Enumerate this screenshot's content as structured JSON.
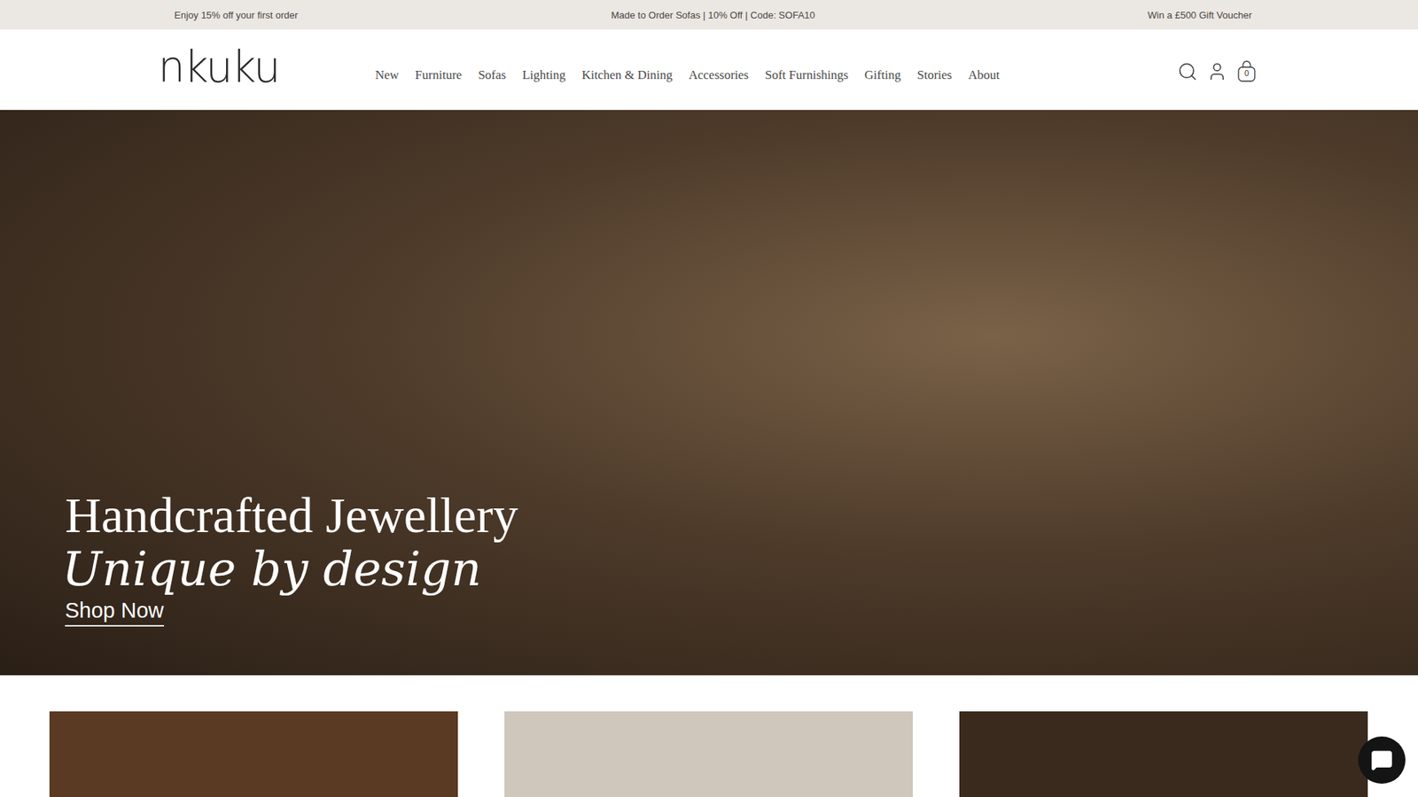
{
  "announcements": [
    "Enjoy 15% off your first order",
    "Made to Order Sofas | 10% Off | Code: SOFA10",
    "Win a £500 Gift Voucher"
  ],
  "logo": "nkuku",
  "nav": [
    {
      "label": "New"
    },
    {
      "label": "Furniture"
    },
    {
      "label": "Sofas"
    },
    {
      "label": "Lighting"
    },
    {
      "label": "Kitchen & Dining"
    },
    {
      "label": "Accessories"
    },
    {
      "label": "Soft Furnishings"
    },
    {
      "label": "Gifting"
    },
    {
      "label": "Stories"
    },
    {
      "label": "About"
    }
  ],
  "cart": {
    "count": "0"
  },
  "hero": {
    "title": "Handcrafted Jewellery",
    "subtitle": "Unique by design",
    "cta": "Shop Now"
  },
  "cards": [
    {
      "color": "#5a3a22"
    },
    {
      "color": "#cfc6bc"
    },
    {
      "color": "#3a2a1e"
    }
  ]
}
